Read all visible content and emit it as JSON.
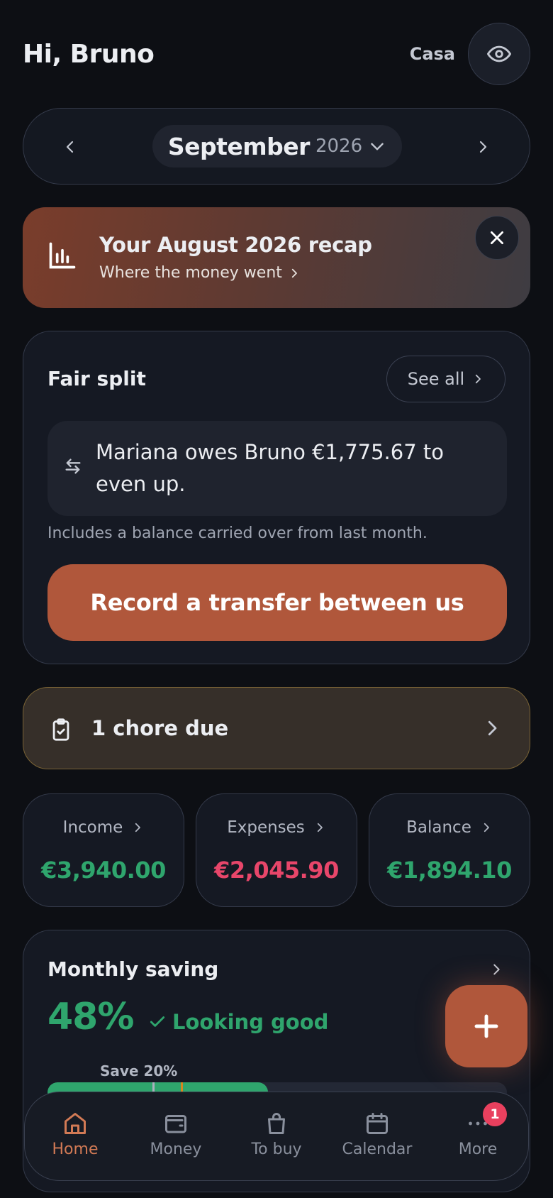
{
  "header": {
    "greeting": "Hi, Bruno",
    "household": "Casa"
  },
  "month_selector": {
    "month": "September",
    "year": "2026"
  },
  "recap": {
    "title": "Your August 2026 recap",
    "subtitle": "Where the money went"
  },
  "fair_split": {
    "title": "Fair split",
    "see_all_label": "See all",
    "message": "Mariana owes Bruno €1,775.67 to even up.",
    "note": "Includes a balance carried over from last month.",
    "action_label": "Record a transfer between us"
  },
  "chores": {
    "label": "1 chore due"
  },
  "stats": [
    {
      "label": "Income",
      "value": "€3,940.00",
      "color": "#2fa56d"
    },
    {
      "label": "Expenses",
      "value": "€2,045.90",
      "color": "#e8466a"
    },
    {
      "label": "Balance",
      "value": "€1,894.10",
      "color": "#2fa56d"
    }
  ],
  "saving": {
    "title": "Monthly saving",
    "percent_label": "48%",
    "status": "Looking good",
    "target_label": "Save 20%",
    "progress_fraction": 0.48,
    "target_fraction": 0.2,
    "marker_fraction": 0.29
  },
  "nav": {
    "items": [
      {
        "label": "Home",
        "icon": "home-icon",
        "active": true
      },
      {
        "label": "Money",
        "icon": "wallet-icon"
      },
      {
        "label": "To buy",
        "icon": "shopping-bag-icon"
      },
      {
        "label": "Calendar",
        "icon": "calendar-icon"
      },
      {
        "label": "More",
        "icon": "more-icon",
        "badge": "1"
      }
    ]
  },
  "colors": {
    "accent": "#b0573b",
    "positive": "#2fa56d",
    "negative": "#e8466a",
    "background": "#0d0f14"
  }
}
